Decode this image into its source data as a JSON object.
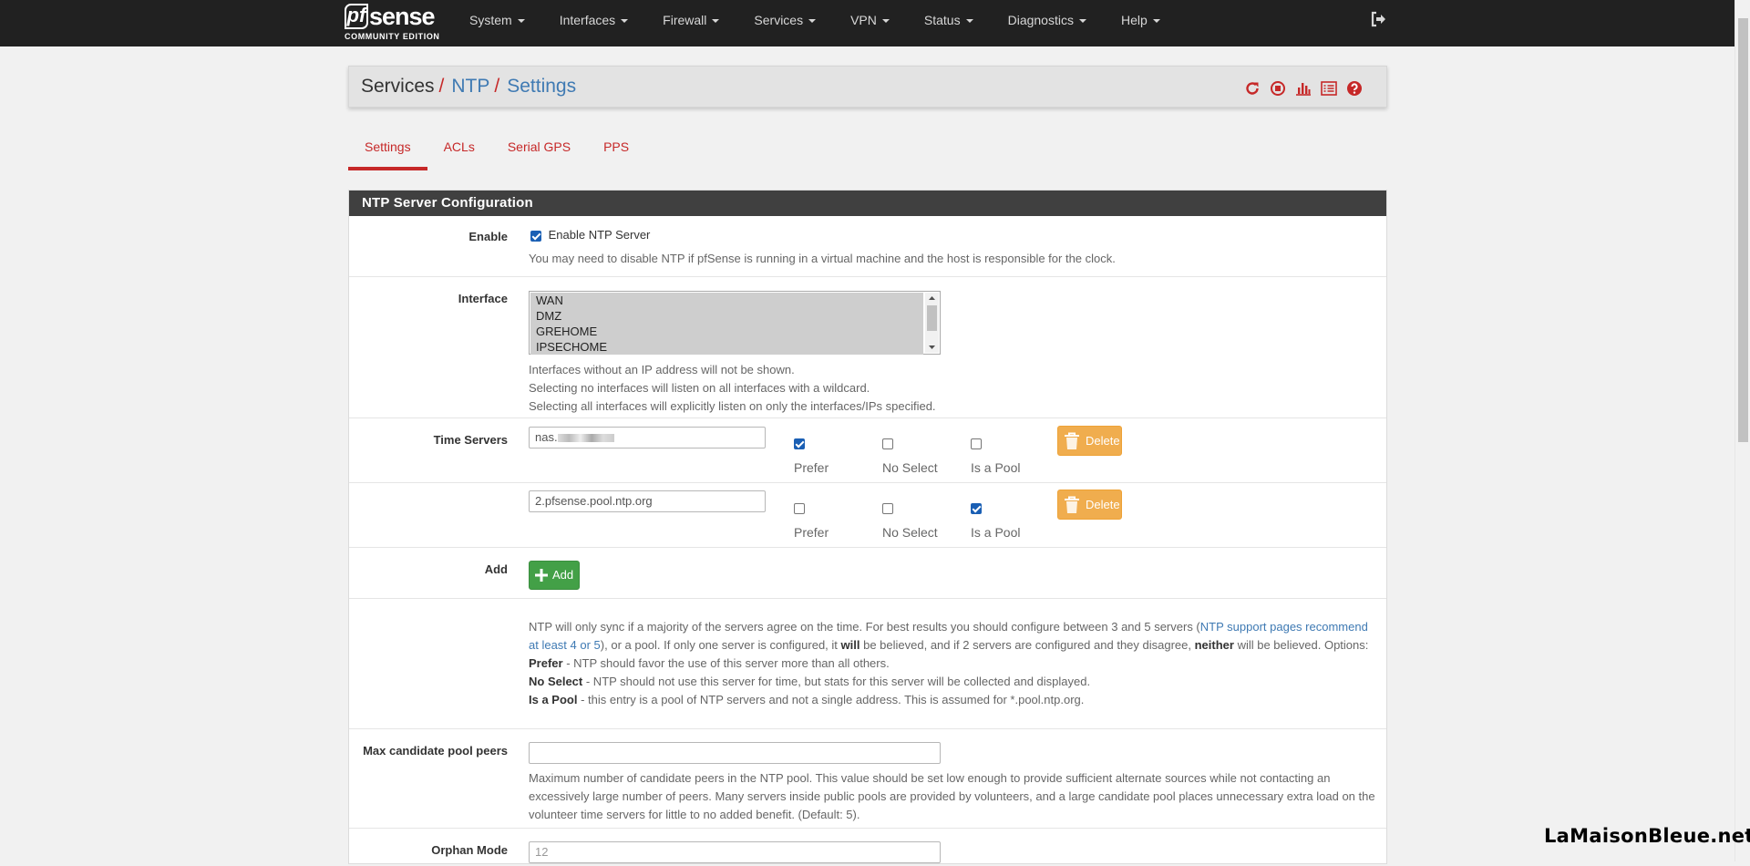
{
  "nav": {
    "logo_main": "sense",
    "logo_pf": "pf",
    "logo_edition": "COMMUNITY EDITION",
    "menu": [
      "System",
      "Interfaces",
      "Firewall",
      "Services",
      "VPN",
      "Status",
      "Diagnostics",
      "Help"
    ]
  },
  "breadcrumb": {
    "root": "Services",
    "sep": "/",
    "level1": "NTP",
    "level2": "Settings"
  },
  "header_icons": [
    "restart-service-icon",
    "stop-service-icon",
    "graph-icon",
    "log-icon",
    "help-icon"
  ],
  "tabs": [
    "Settings",
    "ACLs",
    "Serial GPS",
    "PPS"
  ],
  "panel": {
    "title": "NTP Server Configuration",
    "enable": {
      "label": "Enable",
      "checkbox_label": "Enable NTP Server",
      "checked": true,
      "help": "You may need to disable NTP if pfSense is running in a virtual machine and the host is responsible for the clock."
    },
    "interface": {
      "label": "Interface",
      "options": [
        "WAN",
        "DMZ",
        "GREHOME",
        "IPSECHOME"
      ],
      "help1": "Interfaces without an IP address will not be shown.",
      "help2": "Selecting no interfaces will listen on all interfaces with a wildcard.",
      "help3": "Selecting all interfaces will explicitly listen on only the interfaces/IPs specified."
    },
    "time_servers": {
      "label": "Time Servers",
      "prefer_label": "Prefer",
      "noselect_label": "No Select",
      "pool_label": "Is a Pool",
      "delete_label": "Delete",
      "servers": [
        {
          "host": "nas.",
          "prefer": true,
          "noselect": false,
          "pool": false
        },
        {
          "host": "2.pfsense.pool.ntp.org",
          "prefer": false,
          "noselect": false,
          "pool": true
        }
      ]
    },
    "add": {
      "label": "Add",
      "button": "Add"
    },
    "info": {
      "p1_a": "NTP will only sync if a majority of the servers agree on the time. For best results you should configure between 3 and 5 servers (",
      "p1_link": "NTP support pages recommend at least 4 or 5",
      "p1_b": "), or a pool. If only one server is configured, it ",
      "p1_will": "will",
      "p1_c": " be believed, and if 2 servers are configured and they disagree, ",
      "p1_neither": "neither",
      "p1_d": " will be believed. Options:",
      "prefer_term": "Prefer",
      "prefer_desc": " - NTP should favor the use of this server more than all others.",
      "noselect_term": "No Select",
      "noselect_desc": " - NTP should not use this server for time, but stats for this server will be collected and displayed.",
      "pool_term": "Is a Pool",
      "pool_desc": " - this entry is a pool of NTP servers and not a single address. This is assumed for *.pool.ntp.org."
    },
    "max_peers": {
      "label": "Max candidate pool peers",
      "value": "",
      "help": "Maximum number of candidate peers in the NTP pool. This value should be set low enough to provide sufficient alternate sources while not contacting an excessively large number of peers. Many servers inside public pools are provided by volunteers, and a large candidate pool places unnecessary extra load on the volunteer time servers for little to no added benefit. (Default: 5)."
    },
    "orphan": {
      "label": "Orphan Mode",
      "placeholder": "12"
    }
  },
  "watermark": "LaMaisonBleue.net",
  "colors": {
    "accent": "#c62828",
    "link": "#3f7ab3",
    "navbar": "#212121",
    "delete": "#f0ad4e",
    "add": "#43a047"
  }
}
